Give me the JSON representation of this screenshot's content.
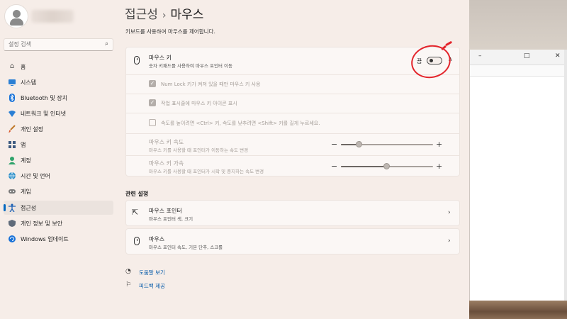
{
  "sidebar": {
    "search_placeholder": "설정 검색",
    "items": [
      {
        "label": "홈",
        "icon": "home-icon"
      },
      {
        "label": "시스템",
        "icon": "system-icon"
      },
      {
        "label": "Bluetooth 및 장치",
        "icon": "bluetooth-icon"
      },
      {
        "label": "네트워크 및 인터넷",
        "icon": "network-icon"
      },
      {
        "label": "개인 설정",
        "icon": "brush-icon"
      },
      {
        "label": "앱",
        "icon": "apps-icon"
      },
      {
        "label": "계정",
        "icon": "account-icon"
      },
      {
        "label": "시간 및 언어",
        "icon": "globe-icon"
      },
      {
        "label": "게임",
        "icon": "gamepad-icon"
      },
      {
        "label": "접근성",
        "icon": "accessibility-icon",
        "active": true
      },
      {
        "label": "개인 정보 및 보안",
        "icon": "shield-icon"
      },
      {
        "label": "Windows 업데이트",
        "icon": "update-icon"
      }
    ]
  },
  "header": {
    "breadcrumb_parent": "접근성",
    "breadcrumb_separator": "›",
    "breadcrumb_current": "마우스",
    "description": "키보드를 사용하여 마우스를 제어합니다."
  },
  "mouse_keys": {
    "title": "마우스 키",
    "subtitle": "숫자 키패드를 사용하여 마우스 포인터 이동",
    "toggle_state": "끔",
    "numlock_option": "Num Lock 키가 켜져 있을 때만 마우스 키 사용",
    "taskbar_option": "작업 표시줄에 마우스 키 아이콘 표시",
    "ctrl_shift_option": "속도를 높이려면 <Ctrl> 키, 속도를 낮추려면 <Shift> 키를 길게 누르세요.",
    "speed_title": "마우스 키 속도",
    "speed_subtitle": "마우스 키를 사용할 때 포인터가 이동하는 속도 변경",
    "speed_value": 0.2,
    "accel_title": "마우스 키 가속",
    "accel_subtitle": "마우스 키를 사용할 때 포인터가 시작 및 중지하는 속도 변경",
    "accel_value": 0.5
  },
  "related": {
    "heading": "관련 설정",
    "items": [
      {
        "title": "마우스 포인터",
        "subtitle": "마우스 포인터 색, 크기"
      },
      {
        "title": "마우스",
        "subtitle": "마우스 포인터 속도, 기본 단추, 스크롤"
      }
    ]
  },
  "footer_links": {
    "help": "도움말 보기",
    "feedback": "피드백 제공"
  },
  "colors": {
    "accent": "#0067c0",
    "annotation": "#e3242b",
    "link": "#0058a8"
  }
}
